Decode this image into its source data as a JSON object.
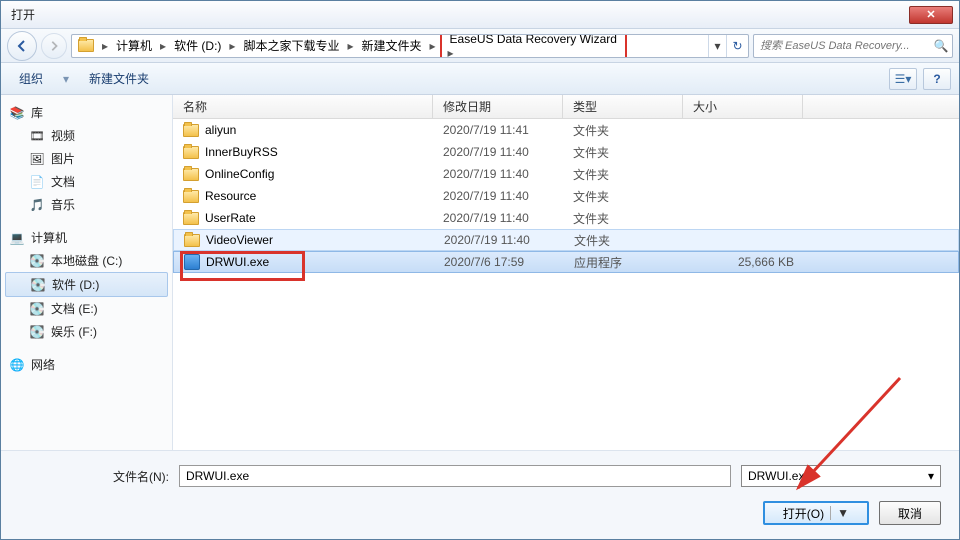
{
  "title": "打开",
  "breadcrumbs": [
    "计算机",
    "软件 (D:)",
    "脚本之家下载专业",
    "新建文件夹",
    "EaseUS Data Recovery Wizard"
  ],
  "search_placeholder": "搜索 EaseUS Data Recovery...",
  "toolbar": {
    "organize": "组织",
    "newfolder": "新建文件夹"
  },
  "columns": {
    "name": "名称",
    "date": "修改日期",
    "type": "类型",
    "size": "大小"
  },
  "sidebar": {
    "library": {
      "label": "库",
      "items": [
        "视频",
        "图片",
        "文档",
        "音乐"
      ]
    },
    "computer": {
      "label": "计算机",
      "items": [
        "本地磁盘 (C:)",
        "软件 (D:)",
        "文档 (E:)",
        "娱乐 (F:)"
      ],
      "selected": 1
    },
    "network": {
      "label": "网络"
    }
  },
  "files": [
    {
      "name": "aliyun",
      "date": "2020/7/19 11:41",
      "type": "文件夹",
      "size": "",
      "kind": "folder"
    },
    {
      "name": "InnerBuyRSS",
      "date": "2020/7/19 11:40",
      "type": "文件夹",
      "size": "",
      "kind": "folder"
    },
    {
      "name": "OnlineConfig",
      "date": "2020/7/19 11:40",
      "type": "文件夹",
      "size": "",
      "kind": "folder"
    },
    {
      "name": "Resource",
      "date": "2020/7/19 11:40",
      "type": "文件夹",
      "size": "",
      "kind": "folder"
    },
    {
      "name": "UserRate",
      "date": "2020/7/19 11:40",
      "type": "文件夹",
      "size": "",
      "kind": "folder"
    },
    {
      "name": "VideoViewer",
      "date": "2020/7/19 11:40",
      "type": "文件夹",
      "size": "",
      "kind": "folder",
      "hovered": true
    },
    {
      "name": "DRWUI.exe",
      "date": "2020/7/6 17:59",
      "type": "应用程序",
      "size": "25,666 KB",
      "kind": "exe",
      "selected": true
    }
  ],
  "filename_label": "文件名(N):",
  "filename_value": "DRWUI.exe",
  "filetype_value": "DRWUI.exe",
  "buttons": {
    "open": "打开(O)",
    "cancel": "取消"
  }
}
